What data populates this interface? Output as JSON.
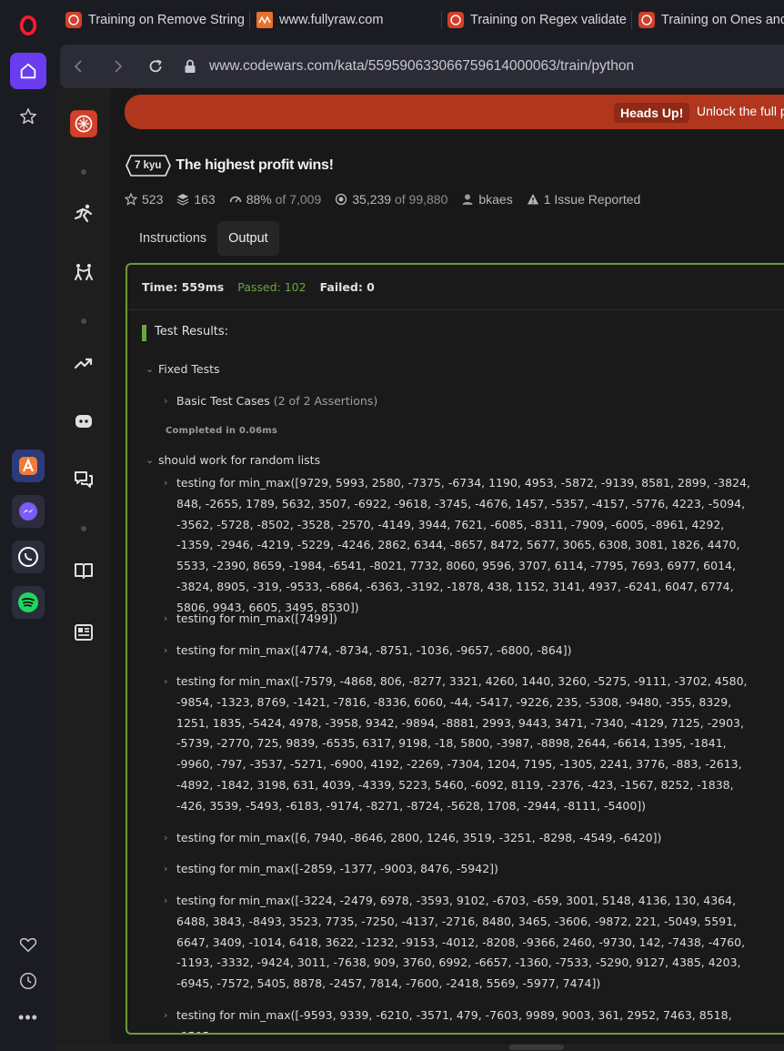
{
  "browser": {
    "tabs": [
      {
        "title": "Training on Remove String"
      },
      {
        "title": "www.fullyraw.com"
      },
      {
        "title": "Training on Regex validate"
      },
      {
        "title": "Training on Ones and"
      }
    ],
    "url": "www.codewars.com/kata/55959063306675961400006­3/train/python"
  },
  "banner": {
    "badge": "Heads Up!",
    "text": "Unlock the full p"
  },
  "kata": {
    "kyu": "7 kyu",
    "title": "The highest profit wins!",
    "meta": {
      "stars": "523",
      "collections": "163",
      "satisfaction": "88%",
      "satisfaction_total": "of 7,009",
      "completed": "35,239",
      "completed_total": "of 99,880",
      "author": "bkaes",
      "issues": "1 Issue Reported"
    },
    "tabs": [
      "Instructions",
      "Output"
    ]
  },
  "output": {
    "time": "Time: 559ms",
    "passed": "Passed: 102",
    "failed": "Failed: 0",
    "results_title": "Test Results:",
    "fixed_tests": "Fixed Tests",
    "basic_cases": "Basic Test Cases",
    "basic_cases_note": "(2 of 2 Assertions)",
    "completed": "Completed in 0.06ms",
    "random_group": "should work for random lists",
    "tests": [
      "testing for min_max([9729, 5993, 2580, -7375, -6734, 1190, 4953, -5872, -9139, 8581, 2899, -3824, 848, -2655, 1789, 5632, 3507, -6922, -9618, -3745, -4676, 1457, -5357, -4157, -5776, 4223, -5094, -3562, -5728, -8502, -3528, -2570, -4149, 3944, 7621, -6085, -8311, -7909, -6005, -8961, 4292, -1359, -2946, -4219, -5229, -4246, 2862, 6344, -8657, 8472, 5677, 3065, 6308, 3081, 1826, 4470, 5533, -2390, 8659, -1984, -6541, -8021, 7732, 8060, 9596, 3707, 6114, -7795, 7693, 6977, 6014, -3824, 8905, -319, -9533, -6864, -6363, -3192, -1878, 438, 1152, 3141, 4937, -6241, 6047, 6774, 5806, 9943, 6605, 3495, 8530])",
      "testing for min_max([7499])",
      "testing for min_max([4774, -8734, -8751, -1036, -9657, -6800, -864])",
      "testing for min_max([-7579, -4868, 806, -8277, 3321, 4260, 1440, 3260, -5275, -9111, -3702, 4580, -9854, -1323, 8769, -1421, -7816, -8336, 6060, -44, -5417, -9226, 235, -5308, -9480, -355, 8329, 1251, 1835, -5424, 4978, -3958, 9342, -9894, -8881, 2993, 9443, 3471, -7340, -4129, 7125, -2903, -5739, -2770, 725, 9839, -6535, 6317, 9198, -18, 5800, -3987, -8898, 2644, -6614, 1395, -1841, -9960, -797, -3537, -5271, -6900, 4192, -2269, -7304, 1204, 7195, -1305, 2241, 3776, -883, -2613, -4892, -1842, 3198, 631, 4039, -4339, 5223, 5460, -6092, 8119, -2376, -423, -1567, 8252, -1838, -426, 3539, -5493, -6183, -9174, -8271, -8724, -5628, 1708, -2944, -8111, -5400])",
      "testing for min_max([6, 7940, -8646, 2800, 1246, 3519, -3251, -8298, -4549, -6420])",
      "testing for min_max([-2859, -1377, -9003, 8476, -5942])",
      "testing for min_max([-3224, -2479, 6978, -3593, 9102, -6703, -659, 3001, 5148, 4136, 130, 4364, 6488, 3843, -8493, 3523, 7735, -7250, -4137, -2716, 8480, 3465, -3606, -9872, 221, -5049, 5591, 6647, 3409, -1014, 6418, 3622, -1232, -9153, -4012, -8208, -9366, 2460, -9730, 142, -7438, -4760, -1193, -3332, -9424, 3011, -7638, 909, 3760, 6992, -6657, -1360, -7533, -5290, 9127, 4385, 4203, -6945, -7572, 5405, 8878, -2457, 7814, -7600, -2418, 5569, -5977, 7474])",
      "testing for min_max([-9593, 9339, -6210, -3571, 479, -7603, 9989, 9003, 361, 2952, 7463, 8518, -9505,"
    ]
  },
  "colors": {
    "accent_green": "#6ba53d",
    "banner_red": "#b1361e",
    "opera_purple": "#6a3df1"
  }
}
